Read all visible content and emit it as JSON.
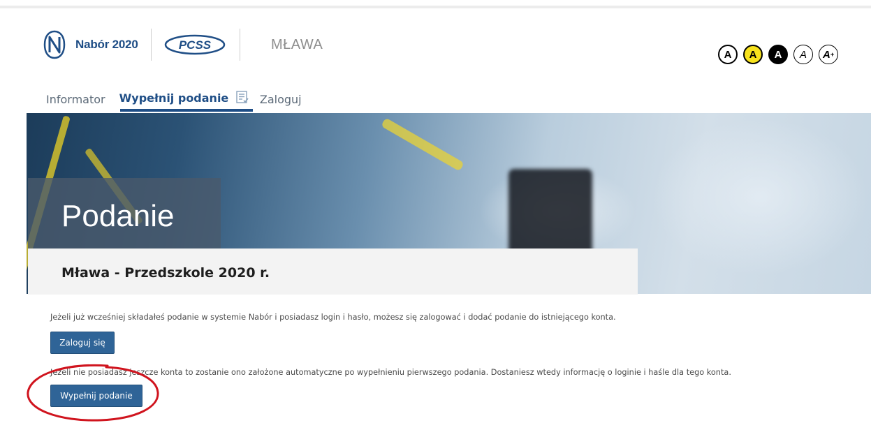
{
  "header": {
    "brand": "Nabór 2020",
    "partner_logo": "PCSS",
    "city": "MŁAWA"
  },
  "accessibility": {
    "buttons": [
      "A",
      "A",
      "A",
      "A",
      "A"
    ],
    "plus": "+"
  },
  "nav": {
    "items": [
      {
        "label": "Informator"
      },
      {
        "label": "Wypełnij podanie"
      },
      {
        "label": "Zaloguj"
      }
    ]
  },
  "hero": {
    "title": "Podanie",
    "subtitle": "Mława - Przedszkole 2020 r."
  },
  "content": {
    "login_info": "Jeżeli już wcześniej składałeś podanie w systemie Nabór i posiadasz login i hasło, możesz się zalogować i dodać podanie do istniejącego konta.",
    "login_button": "Zaloguj się",
    "new_info": "Jeżeli nie posiadasz jeszcze konta to zostanie ono założone automatyczne po wypełnieniu pierwszego podania. Dostaniesz wtedy informację o loginie i haśle dla tego konta.",
    "fill_button": "Wypełnij podanie"
  },
  "colors": {
    "brand_blue": "#1f4e86",
    "button_blue": "#2f6497",
    "annotation_red": "#d0141e",
    "contrast_yellow": "#f7e21c"
  }
}
